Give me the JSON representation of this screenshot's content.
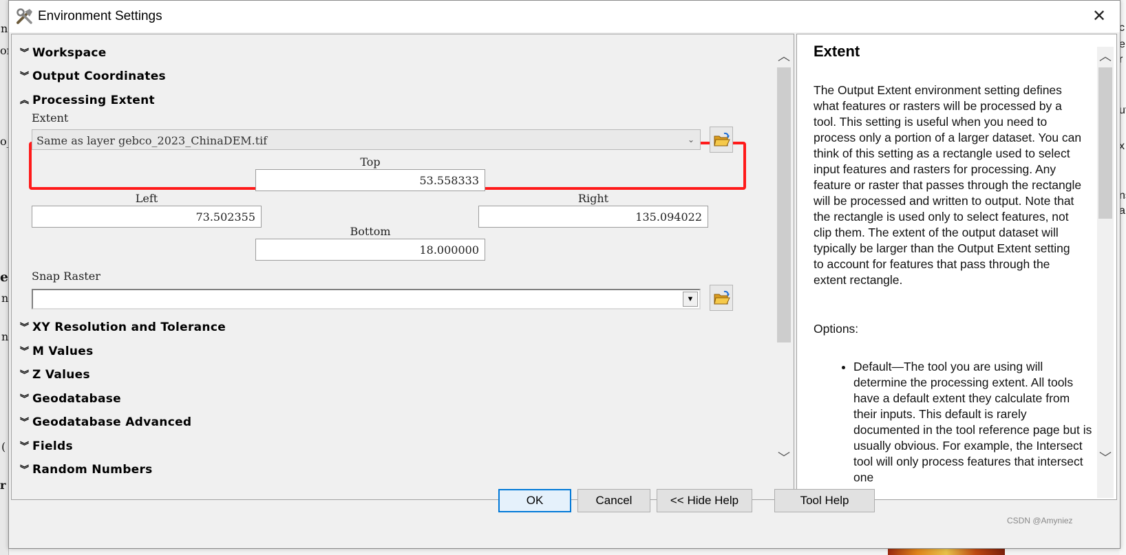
{
  "window": {
    "title": "Environment Settings",
    "close_glyph": "✕"
  },
  "sections_top": [
    {
      "label": "Workspace",
      "icon": "chevron-double-down-icon"
    },
    {
      "label": "Output Coordinates",
      "icon": "chevron-double-down-icon"
    },
    {
      "label": "Processing Extent",
      "icon": "chevron-double-up-icon"
    }
  ],
  "extent": {
    "label": "Extent",
    "value": "Same as layer gebco_2023_ChinaDEM.tif",
    "top_label": "Top",
    "top": "53.558333",
    "left_label": "Left",
    "left": "73.502355",
    "right_label": "Right",
    "right": "135.094022",
    "bottom_label": "Bottom",
    "bottom": "18.000000"
  },
  "snap_raster": {
    "label": "Snap Raster",
    "value": ""
  },
  "sections_bottom": [
    {
      "label": "XY Resolution and Tolerance"
    },
    {
      "label": "M Values"
    },
    {
      "label": "Z Values"
    },
    {
      "label": "Geodatabase"
    },
    {
      "label": "Geodatabase Advanced"
    },
    {
      "label": "Fields"
    },
    {
      "label": "Random Numbers"
    }
  ],
  "help": {
    "title": "Extent",
    "body": "The Output Extent environment setting defines what features or rasters will be processed by a tool. This setting is useful when you need to process only a portion of a larger dataset. You can think of this setting as a rectangle used to select input features and rasters for processing. Any feature or raster that passes through the rectangle will be processed and written to output. Note that the rectangle is used only to select features, not clip them. The extent of the output dataset will typically be larger than the Output Extent setting to account for features that pass through the extent rectangle.",
    "options_label": "Options:",
    "options": [
      "Default—The tool you are using will determine the processing extent. All tools have a default extent they calculate from their inputs. This default is rarely documented in the tool reference page but is usually obvious. For example, the Intersect tool will only process features that intersect one"
    ]
  },
  "buttons": {
    "ok": "OK",
    "cancel": "Cancel",
    "hide_help": "<< Hide Help",
    "tool_help": "Tool Help"
  },
  "background_fragments": [
    "n",
    "or",
    "o_",
    "et",
    "n",
    "n",
    "(",
    "r",
    "c",
    "e",
    "r",
    "ut",
    "x",
    "ns",
    "a"
  ],
  "watermark": "CSDN @Amyniez",
  "colors": {
    "highlight": "#ff1a1a",
    "dialog_bg": "#f0f0f0",
    "primary_border": "#0078d7"
  }
}
